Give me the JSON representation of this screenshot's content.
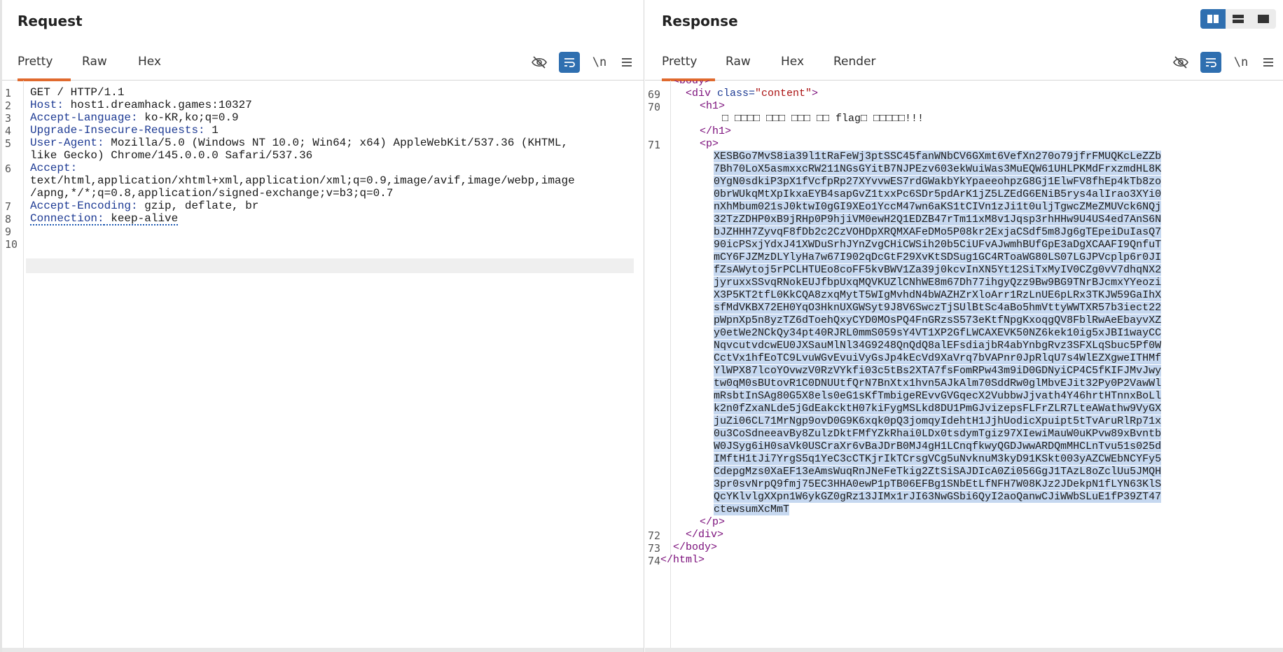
{
  "request": {
    "title": "Request",
    "tabs": [
      "Pretty",
      "Raw",
      "Hex"
    ],
    "active_tab": "Pretty",
    "tools": {
      "hide_icon": "eye-off-icon",
      "wrap_icon": "wrap-icon",
      "newline_label": "\\n",
      "menu_icon": "menu-icon"
    },
    "lines": [
      {
        "n": "1",
        "name": "",
        "rest": "GET / HTTP/1.1"
      },
      {
        "n": "2",
        "name": "Host:",
        "rest": " host1.dreamhack.games:10327"
      },
      {
        "n": "3",
        "name": "Accept-Language:",
        "rest": " ko-KR,ko;q=0.9"
      },
      {
        "n": "4",
        "name": "Upgrade-Insecure-Requests:",
        "rest": " 1"
      },
      {
        "n": "5",
        "name": "User-Agent:",
        "rest": " Mozilla/5.0 (Windows NT 10.0; Win64; x64) AppleWebKit/537.36 (KHTML,"
      },
      {
        "n": "",
        "name": "",
        "rest": "like Gecko) Chrome/145.0.0.0 Safari/537.36"
      },
      {
        "n": "6",
        "name": "Accept:",
        "rest": ""
      },
      {
        "n": "",
        "name": "",
        "rest": "text/html,application/xhtml+xml,application/xml;q=0.9,image/avif,image/webp,image"
      },
      {
        "n": "",
        "name": "",
        "rest": "/apng,*/*;q=0.8,application/signed-exchange;v=b3;q=0.7"
      },
      {
        "n": "7",
        "name": "Accept-Encoding:",
        "rest": " gzip, deflate, br"
      },
      {
        "n": "8",
        "name": "Connection:",
        "rest": " keep-alive"
      },
      {
        "n": "9",
        "name": "",
        "rest": ""
      },
      {
        "n": "10",
        "name": "",
        "rest": ""
      }
    ]
  },
  "response": {
    "title": "Response",
    "tabs": [
      "Pretty",
      "Raw",
      "Hex",
      "Render"
    ],
    "active_tab": "Pretty",
    "tools": {
      "hide_icon": "eye-off-icon",
      "wrap_icon": "wrap-icon",
      "newline_label": "\\n",
      "menu_icon": "menu-icon"
    },
    "layout_icons": [
      "split-columns-icon",
      "split-rows-icon",
      "single-pane-icon"
    ],
    "top_partial": "<body>",
    "div_open": {
      "n": "69",
      "open": "<div ",
      "attr": "class=",
      "val": "\"content\"",
      "close": ">"
    },
    "h1_open": {
      "n": "70",
      "text": "<h1>"
    },
    "h1_text": "□ □□□□ □□□ □□□ □□ flag□ □□□□□!!!",
    "h1_close": "</h1>",
    "p_open": {
      "n": "71",
      "text": "<p>"
    },
    "blob": [
      "XESBGo7MvS8ia39l1tRaFeWj3ptSSC45fanWNbCV6GXmt6VefXn270o79jfrFMUQKcLeZZb",
      "7Bh70LoX5asmxxcRW211NGsGYitB7NJPEzv603ekWuiWas3MuEQW61UHLPKMdFrxzmdHL8K",
      "0YgN0sdkiP3pX1fVcfpRp27XYvvwES7rdGWakbYkYpaeeohpzG8Gj1ElwFV8fhEp4kTb8zo",
      "0brWUkqMtXpIkxaEYB4sapGvZ1txxPc6SDr5pdArK1jZ5LZEdG6ENiB5rys4alIrao3XYi0",
      "nXhMbum021sJ0ktwI0gGI9XEo1YccM47wn6aKS1tCIVn1zJi1t0uljTgwcZMeZMUVck6NQj",
      "32TzZDHP0xB9jRHp0P9hjiVM0ewH2Q1EDZB47rTm11xM8v1Jqsp3rhHHw9U4US4ed7AnS6N",
      "bJZHHH7ZyvqF8fDb2c2CzVOHDpXRQMXAFeDMo5P08kr2ExjaCSdf5m8Jg6gTEpeiDuIasQ7",
      "90icPSxjYdxJ41XWDuSrhJYnZvgCHiCWSih20b5CiUFvAJwmhBUfGpE3aDgXCAAFI9QnfuT",
      "mCY6FJZMzDLYlyHa7w67I902qDcGtF29XvKtSDSug1GC4RToaWG80LS07LGJPVcplp6r0JI",
      "fZsAWytoj5rPCLHTUEo8coFF5kvBWV1Za39j0kcvInXN5Yt12SiTxMyIV0CZg0vV7dhqNX2",
      "jyruxxSSvqRNokEUJfbpUxqMQVKUZlCNhWE8m67Dh77ihgyQzz9Bw9BG9TNrBJcmxYYeozi",
      "X3P5KT2tfL0KkCQA8zxqMytT5WIgMvhdN4bWAZHZrXloArr1RzLnUE6pLRx3TKJW59GaIhX",
      "sfMdVKBX72EH0YqO3HknUXGWSyt9J8V6SwczTjSUlBtSc4aBo5hmVttyWWTXR57b3iect22",
      "pWpnXp5n8yzTZ6dToehQxyCYD0MOsPQ4FnGRzsS573eKtfNpgKxoqgQV8FblRwAeEbayvXZ",
      "y0etWe2NCkQy34pt40RJRL0mmS059sY4VT1XP2GfLWCAXEVK50NZ6kek10ig5xJBI1wayCC",
      "NqvcutvdcwEU0JXSauMlNl34G9248QnQdQ8alEFsdiajbR4abYnbgRvz3SFXLqSbuc5Pf0W",
      "CctVx1hfEoTC9LvuWGvEvuiVyGsJp4kEcVd9XaVrq7bVAPnr0JpRlqU7s4WlEZXgweITHMf",
      "YlWPX87lcoYOvwzV0RzVYkfi03c5tBs2XTA7fsFomRPw43m9iD0GDNyiCP4C5fKIFJMvJwy",
      "tw0qM0sBUtovR1C0DNUUtfQrN7BnXtx1hvn5AJkAlm70SddRw0glMbvEJit32Py0P2VawWl",
      "mRsbtInSAg80G5X8els0eG1sKfTmbigeREvvGVGqecX2VubbwJjvath4Y46hrtHTnnxBoLl",
      "k2n0fZxaNLde5jGdEakcktH07kiFygMSLkd8DU1PmGJvizepsFLFrZLR7LteAWathw9VyGX",
      "juZi06CL71MrNgp9ovD0G9K6xqk0pQ3jomqyIdehtH1JjhUodicXpuipt5tTvAruRlRp71x",
      "0u3CoSdneeavBy8ZulzDktFMfYZkRhai0LDx0tsdymTgiz97XIewiMauW0uKPvw89xBvntb",
      "W0JSyg6iH0saVk0USCraXr6vBaJDrB0MJ4gH1LCnqfkwyQGDJwwARDQmMHCLnTvu51s025d",
      "IMftH1tJi7YrgS5q1YeC3cCTKjrIkTCrsgVCg5uNvknuM3kyD91KSkt003yAZCWEbNCYFy5",
      "CdepgMzs0XaEF13eAmsWuqRnJNeFeTkig2ZtSiSAJDIcA0Zi056GgJ1TAzL8oZclUu5JMQH",
      "3pr0svNrpQ9fmj75EC3HHA0ewP1pTB06EFBg1SNbEtLfNFH7W08KJz2JDekpN1fLYN63KlS",
      "QcYKlvlgXXpn1W6ykGZ0gRz13JIMx1rJI63NwGSbi6QyI2aoQanwCJiWWbSLuE1fP39ZT47",
      "ctewsumXcMmT"
    ],
    "p_close": "</p>",
    "div_close": {
      "n": "72",
      "text": "</div>"
    },
    "body_close": {
      "n": "73",
      "text": "</body>"
    },
    "html_close": {
      "n": "74",
      "text": "</html>"
    }
  }
}
